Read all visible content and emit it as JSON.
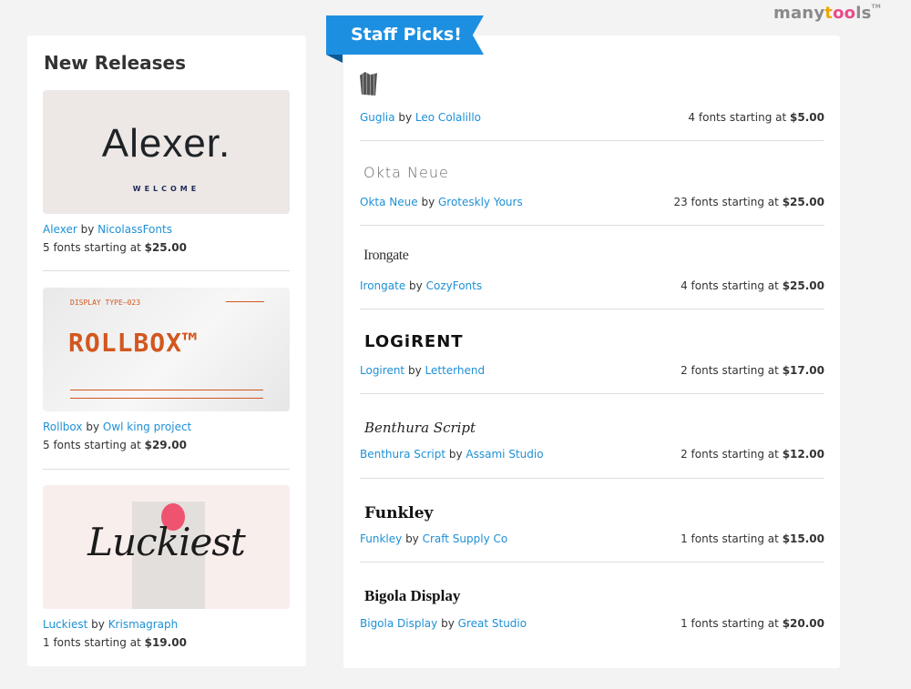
{
  "brand": {
    "logo_pre": "many",
    "logo_o1": "t",
    "logo_mid": "oo",
    "logo_post": "ls",
    "logo_tm": "TM"
  },
  "new_releases": {
    "heading": "New Releases",
    "items": [
      {
        "name": "Alexer",
        "by": "by",
        "author": "NicolassFonts",
        "count_text": "5 fonts starting at",
        "price": "$25.00",
        "thumb_title": "Alexer.",
        "thumb_sub": "WELCOME"
      },
      {
        "name": "Rollbox",
        "by": "by",
        "author": "Owl king project",
        "count_text": "5 fonts starting at",
        "price": "$29.00",
        "thumb_title": "ROLLBOX™",
        "thumb_tag": "DISPLAY TYPE—023"
      },
      {
        "name": "Luckiest",
        "by": "by",
        "author": "Krismagraph",
        "count_text": "1 fonts starting at",
        "price": "$19.00",
        "thumb_title": "Luckiest"
      }
    ]
  },
  "staff_picks": {
    "ribbon_label": "Staff Picks!",
    "items": [
      {
        "sample": "",
        "name": "Guglia",
        "by": "by",
        "author": "Leo Colalillo",
        "count_text": "4 fonts starting at",
        "price": "$5.00"
      },
      {
        "sample": "Okta Neue",
        "name": "Okta Neue",
        "by": "by",
        "author": "Groteskly Yours",
        "count_text": "23 fonts starting at",
        "price": "$25.00"
      },
      {
        "sample": "Irongate",
        "name": "Irongate",
        "by": "by",
        "author": "CozyFonts",
        "count_text": "4 fonts starting at",
        "price": "$25.00"
      },
      {
        "sample": "LOGiRENT",
        "name": "Logirent",
        "by": "by",
        "author": "Letterhend",
        "count_text": "2 fonts starting at",
        "price": "$17.00"
      },
      {
        "sample": "Benthura Script",
        "name": "Benthura Script",
        "by": "by",
        "author": "Assami Studio",
        "count_text": "2 fonts starting at",
        "price": "$12.00"
      },
      {
        "sample": "Funkley",
        "name": "Funkley",
        "by": "by",
        "author": "Craft Supply Co",
        "count_text": "1 fonts starting at",
        "price": "$15.00"
      },
      {
        "sample": "Bigola Display",
        "name": "Bigola Display",
        "by": "by",
        "author": "Great Studio",
        "count_text": "1 fonts starting at",
        "price": "$20.00"
      }
    ]
  },
  "colors": {
    "link": "#1e90d6",
    "ribbon": "#1d8fe0",
    "background": "#f3f3f3"
  }
}
